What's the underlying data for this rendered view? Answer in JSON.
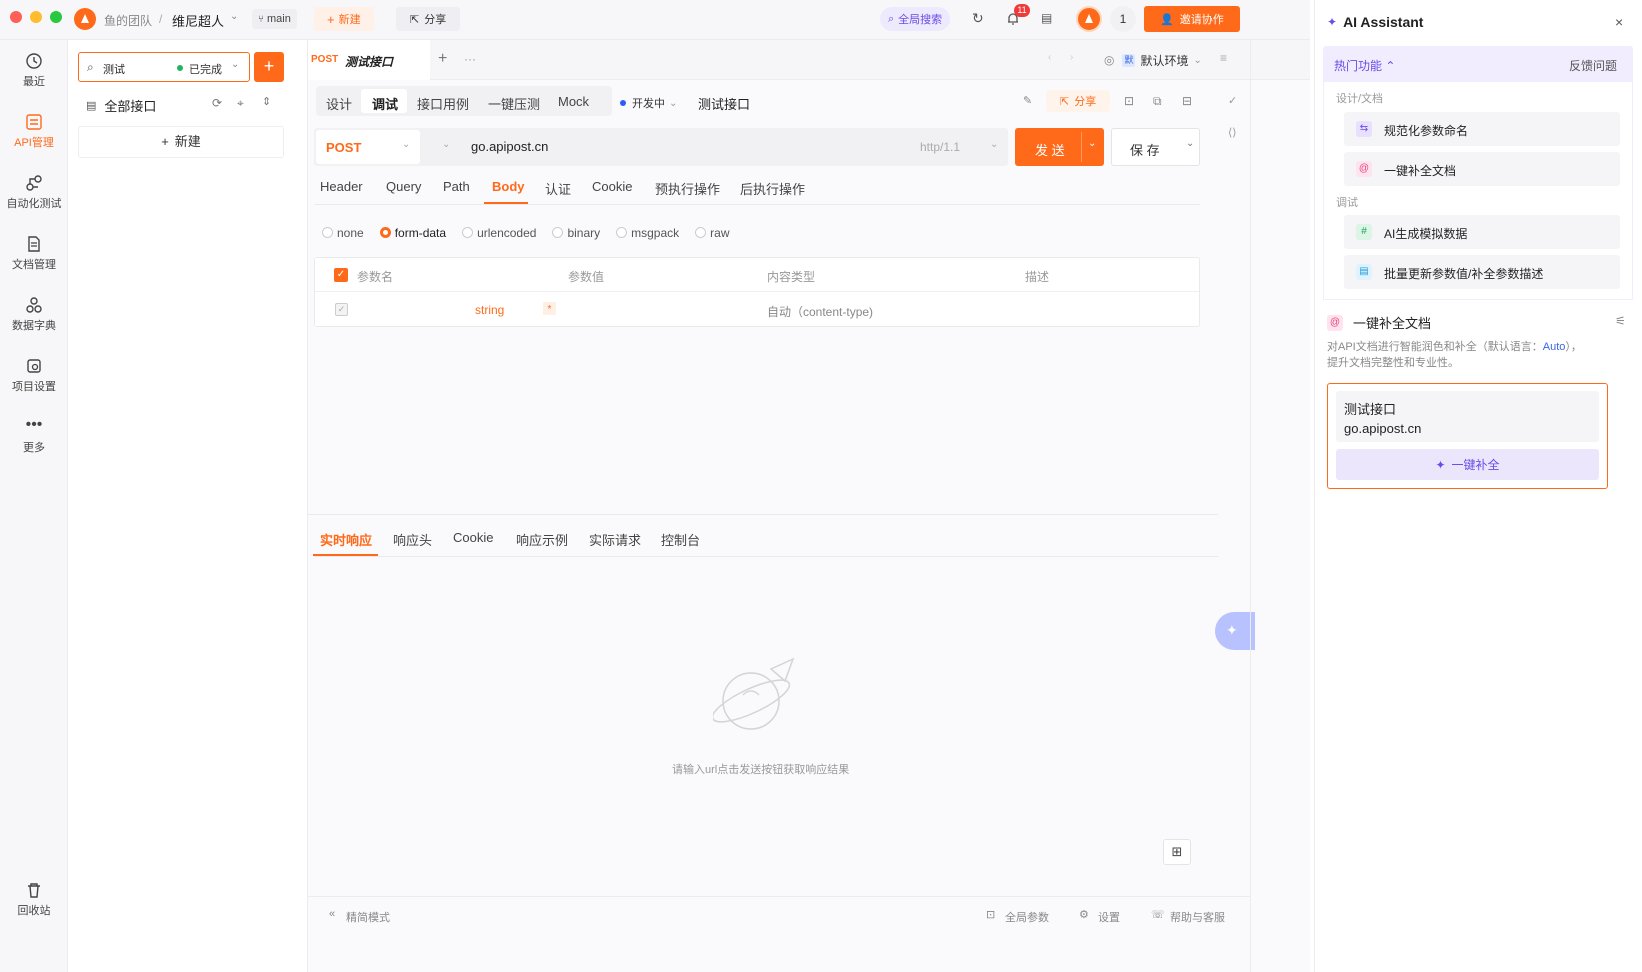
{
  "titlebar": {
    "team": "鱼的团队",
    "separator": "/",
    "project": "维尼超人",
    "branch": "main",
    "new_label": "新建",
    "share_label": "分享",
    "search_label": "全局搜索",
    "notif_count": "11",
    "user_count": "1",
    "invite_label": "邀请协作"
  },
  "leftnav": {
    "items": [
      {
        "label": "最近"
      },
      {
        "label": "API管理"
      },
      {
        "label": "自动化测试"
      },
      {
        "label": "文档管理"
      },
      {
        "label": "数据字典"
      },
      {
        "label": "项目设置"
      },
      {
        "label": "更多"
      },
      {
        "label": "回收站"
      }
    ]
  },
  "sidebar": {
    "search_value": "测试",
    "status": "已完成",
    "all_apis": "全部接口",
    "new_label": "新建"
  },
  "tabbar": {
    "method": "POST",
    "title": "测试接口",
    "env_badge": "默",
    "env": "默认环境"
  },
  "subtabs": {
    "items": [
      "设计",
      "调试",
      "接口用例",
      "一键压测",
      "Mock"
    ],
    "active": "调试",
    "status": "开发中",
    "api_name": "测试接口",
    "share_label": "分享"
  },
  "request": {
    "method": "POST",
    "url": "go.apipost.cn",
    "protocol": "http/1.1",
    "send_label": "发 送",
    "save_label": "保 存"
  },
  "param_tabs": {
    "items": [
      "Header",
      "Query",
      "Path",
      "Body",
      "认证",
      "Cookie",
      "预执行操作",
      "后执行操作"
    ],
    "active": "Body"
  },
  "body_modes": {
    "items": [
      "none",
      "form-data",
      "urlencoded",
      "binary",
      "msgpack",
      "raw"
    ],
    "selected": "form-data"
  },
  "table": {
    "headers": [
      "参数名",
      "参数值",
      "内容类型",
      "描述"
    ],
    "row": {
      "type": "string",
      "required": "*",
      "content_type": "自动（content-type)"
    }
  },
  "response_tabs": {
    "items": [
      "实时响应",
      "响应头",
      "Cookie",
      "响应示例",
      "实际请求",
      "控制台"
    ],
    "active": "实时响应"
  },
  "response": {
    "empty_hint": "请输入url点击发送按钮获取响应结果"
  },
  "footer": {
    "simple_mode": "精简模式",
    "global_params": "全局参数",
    "settings": "设置",
    "help": "帮助与客服"
  },
  "ai": {
    "title": "AI Assistant",
    "hot": "热门功能",
    "feedback": "反馈问题",
    "group1": "设计/文档",
    "item1": "规范化参数命名",
    "item2": "一键补全文档",
    "group2": "调试",
    "item3": "AI生成模拟数据",
    "item4": "批量更新参数值/补全参数描述",
    "section_title": "一键补全文档",
    "desc_pre": "对API文档进行智能润色和补全（默认语言：",
    "desc_lang": "Auto",
    "desc_post": "），",
    "desc_line2": "提升文档完整性和专业性。",
    "card_name": "测试接口",
    "card_url": "go.apipost.cn",
    "complete_btn": "一键补全"
  },
  "colors": {
    "accent": "#ff6a1a",
    "ai_purple": "#6b4ce6",
    "ai_bg": "#f1ecfe"
  }
}
